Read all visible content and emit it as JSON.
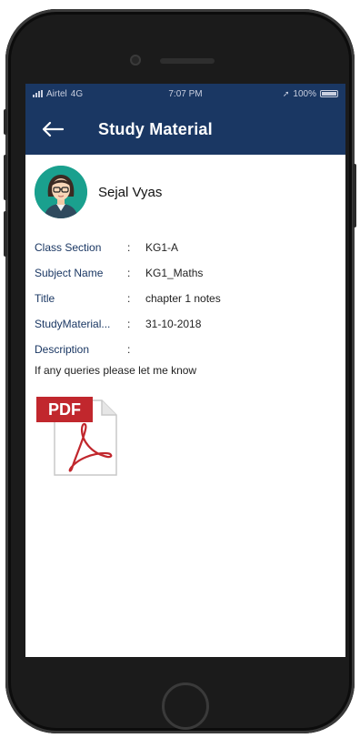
{
  "status_bar": {
    "carrier": "Airtel",
    "network": "4G",
    "time": "7:07 PM",
    "battery": "100%"
  },
  "appbar": {
    "title": "Study Material",
    "back_icon": "arrow-left-icon"
  },
  "profile": {
    "name": "Sejal  Vyas",
    "avatar_icon": "user-avatar-icon"
  },
  "details": [
    {
      "label": "Class Section",
      "value": "KG1-A"
    },
    {
      "label": "Subject Name",
      "value": "KG1_Maths"
    },
    {
      "label": "Title",
      "value": "chapter 1 notes"
    },
    {
      "label": "StudyMaterial...",
      "value": "31-10-2018"
    },
    {
      "label": "Description",
      "value": ""
    }
  ],
  "description_text": "If any queries please let me know",
  "attachment": {
    "type": "PDF",
    "icon": "pdf-file-icon"
  },
  "colors": {
    "appbar_bg": "#1a3763",
    "avatar_bg": "#1aa08e",
    "label_color": "#1a3763",
    "pdf_red": "#c1272d"
  }
}
